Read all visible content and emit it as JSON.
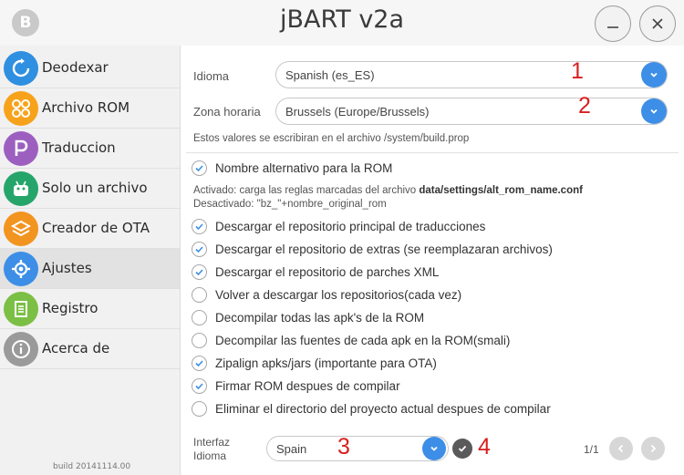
{
  "window": {
    "title": "jBART v2a",
    "logo_letter": "B",
    "minimize_label": "—",
    "close_label": "✕"
  },
  "sidebar": {
    "items": [
      {
        "label": "Deodexar",
        "icon": "refresh-icon",
        "color": "#2f8fe0"
      },
      {
        "label": "Archivo ROM",
        "icon": "grid-icon",
        "color": "#f7a21b"
      },
      {
        "label": "Traduccion",
        "icon": "p-letter-icon",
        "color": "#9c5fc0"
      },
      {
        "label": "Solo un archivo",
        "icon": "android-icon",
        "color": "#26a56a"
      },
      {
        "label": "Creador de OTA",
        "icon": "layers-icon",
        "color": "#f29420"
      },
      {
        "label": "Ajustes",
        "icon": "gear-icon",
        "color": "#3d8ee6",
        "active": true
      },
      {
        "label": "Registro",
        "icon": "document-icon",
        "color": "#7bbf44"
      },
      {
        "label": "Acerca de",
        "icon": "info-icon",
        "color": "#9a9a9a"
      }
    ],
    "build": "build 20141114.00"
  },
  "settings": {
    "idioma": {
      "label": "Idioma",
      "value": "Spanish (es_ES)"
    },
    "zona": {
      "label": "Zona horaria",
      "value": "Brussels (Europe/Brussels)"
    },
    "buildprop_note": "Estos valores se escribiran en el archivo /system/build.prop",
    "alt_name": {
      "label": "Nombre alternativo para la ROM",
      "checked": true,
      "active_prefix": "Activado: carga las reglas marcadas del archivo ",
      "active_path": "data/settings/alt_rom_name.conf",
      "inactive": "Desactivado: \"bz_\"+nombre_original_rom"
    },
    "options": [
      {
        "label": "Descargar el repositorio principal de traducciones",
        "checked": true
      },
      {
        "label": "Descargar el repositorio de extras (se reemplazaran archivos)",
        "checked": true
      },
      {
        "label": "Descargar el repositorio de parches XML",
        "checked": true
      },
      {
        "label": "Volver a descargar los repositorios(cada vez)",
        "checked": false
      },
      {
        "label": "Decompilar todas las apk's de la ROM",
        "checked": false
      },
      {
        "label": "Decompilar las fuentes de cada apk en la ROM(smali)",
        "checked": false
      },
      {
        "label": "Zipalign apks/jars (importante para OTA)",
        "checked": true
      },
      {
        "label": "Firmar ROM despues de compilar",
        "checked": true
      },
      {
        "label": "Eliminar el directorio del proyecto actual despues de compilar",
        "checked": false
      }
    ],
    "interface_label_1": "Interfaz",
    "interface_label_2": "Idioma",
    "interface_value": "Spain",
    "page_indicator": "1/1"
  },
  "annotations": [
    "1",
    "2",
    "3",
    "4"
  ],
  "colors": {
    "accent": "#3d8ee6",
    "annotation": "#d81f1f"
  }
}
